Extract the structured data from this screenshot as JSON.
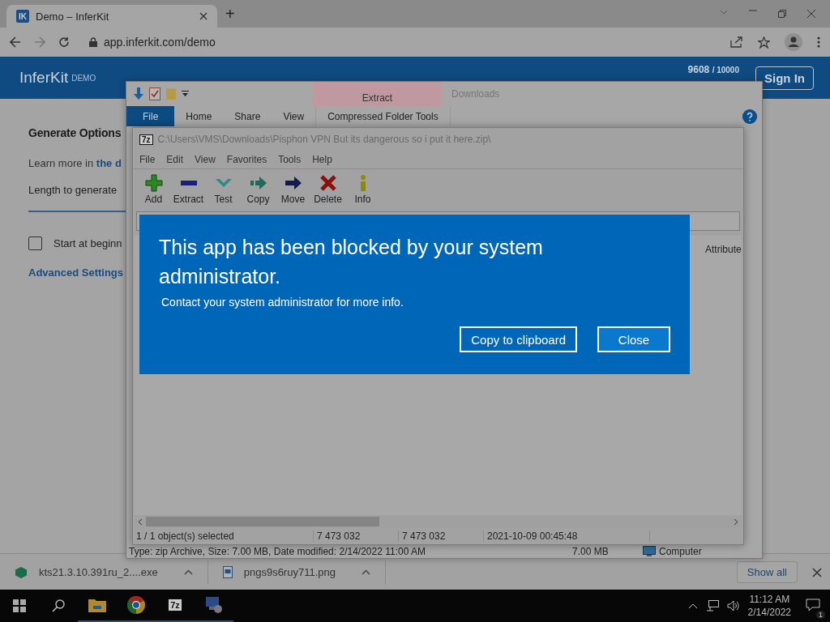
{
  "browser": {
    "tab": {
      "title": "Demo – InferKit",
      "icon_text": "IK"
    },
    "new_tab": "+",
    "url": "app.inferkit.com/demo"
  },
  "site": {
    "logo": "InferKit",
    "logo_badge": "DEMO",
    "usage": "9608",
    "usage_total": "/ 10000",
    "sign_in": "Sign In",
    "options_title": "Generate Options",
    "learn_more": "Learn more in",
    "learn_link": "the d",
    "length_label": "Length to generate",
    "start_checkbox": {
      "label": "Start at beginn",
      "checked": false
    },
    "advanced": "Advanced Settings"
  },
  "explorer": {
    "title": "Downloads",
    "context_tab": "Extract",
    "tabs": [
      {
        "label": "File",
        "selected": true
      },
      {
        "label": "Home",
        "selected": false
      },
      {
        "label": "Share",
        "selected": false
      },
      {
        "label": "View",
        "selected": false
      },
      {
        "label": "Compressed Folder Tools",
        "selected": false
      }
    ],
    "status": "Type: zip Archive, Size: 7.00 MB, Date modified: 2/14/2022 11:00 AM",
    "status_size": "7.00 MB",
    "status_location": "Computer"
  },
  "sevenzip": {
    "logo": "7z",
    "title": "C:\\Users\\VMS\\Downloads\\Pisphon VPN But its dangerous so i put it here.zip\\",
    "menu": [
      "File",
      "Edit",
      "View",
      "Favorites",
      "Tools",
      "Help"
    ],
    "toolbar": [
      {
        "label": "Add",
        "kind": "add"
      },
      {
        "label": "Extract",
        "kind": "extract"
      },
      {
        "label": "Test",
        "kind": "test"
      },
      {
        "label": "Copy",
        "kind": "copy"
      },
      {
        "label": "Move",
        "kind": "move"
      },
      {
        "label": "Delete",
        "kind": "delete"
      },
      {
        "label": "Info",
        "kind": "info"
      }
    ],
    "column_header": "Attribute",
    "status": [
      "1 / 1 object(s) selected",
      "7 473 032",
      "7 473 032",
      "2021-10-09 00:45:48"
    ]
  },
  "dialog": {
    "title": "This app has been blocked by your system administrator.",
    "message": "Contact your system administrator for more info.",
    "buttons": [
      {
        "label": "Copy to clipboard",
        "selected": false
      },
      {
        "label": "Close",
        "selected": true
      }
    ]
  },
  "downloads": {
    "items": [
      {
        "name": "kts21.3.10.391ru_2....exe",
        "kind": "exe"
      },
      {
        "name": "pngs9s6ruy711.png",
        "kind": "image"
      }
    ],
    "show_all": "Show all"
  },
  "taskbar": {
    "apps": [
      {
        "kind": "explorer"
      },
      {
        "kind": "chrome"
      },
      {
        "kind": "sevenzip",
        "text": "7z"
      },
      {
        "kind": "network"
      }
    ],
    "time": "11:12 AM",
    "date": "2/14/2022",
    "notifications": "1"
  }
}
